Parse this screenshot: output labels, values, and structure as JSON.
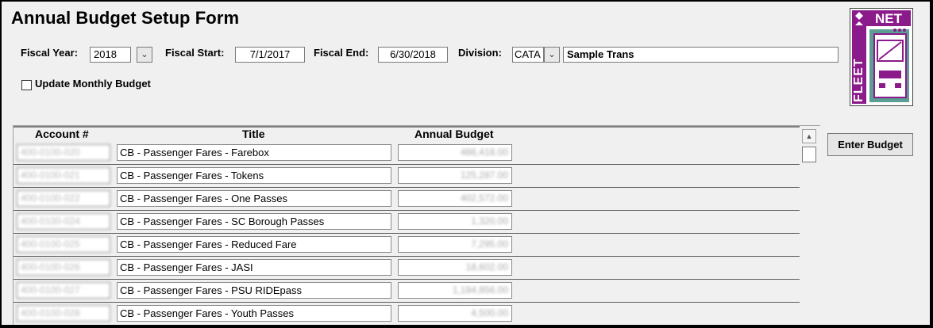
{
  "form": {
    "title": "Annual Budget Setup Form",
    "fiscal_year_label": "Fiscal Year:",
    "fiscal_year_value": "2018",
    "fiscal_start_label": "Fiscal Start:",
    "fiscal_start_value": "7/1/2017",
    "fiscal_end_label": "Fiscal End:",
    "fiscal_end_value": "6/30/2018",
    "division_label": "Division:",
    "division_code": "CATA",
    "division_name": "Sample Trans",
    "update_monthly_label": "Update Monthly Budget",
    "update_monthly_checked": false,
    "enter_budget_label": "Enter Budget"
  },
  "logo": {
    "text_top": "NET",
    "text_side": "FLEET",
    "colors": {
      "purple": "#8b1a8b",
      "teal": "#5a9e94"
    }
  },
  "grid": {
    "columns": [
      "Account #",
      "Title",
      "Annual Budget"
    ],
    "rows": [
      {
        "account": "400-0100-020",
        "title": "CB - Passenger Fares - Farebox",
        "budget": "486,418.00"
      },
      {
        "account": "400-0100-021",
        "title": "CB - Passenger Fares - Tokens",
        "budget": "125,287.00"
      },
      {
        "account": "400-0100-022",
        "title": "CB - Passenger Fares - One Passes",
        "budget": "402,572.00"
      },
      {
        "account": "400-0100-024",
        "title": "CB - Passenger Fares - SC Borough Passes",
        "budget": "1,320.00"
      },
      {
        "account": "400-0100-025",
        "title": "CB - Passenger Fares - Reduced Fare",
        "budget": "7,295.00"
      },
      {
        "account": "400-0100-026",
        "title": "CB - Passenger Fares - JASI",
        "budget": "18,602.00"
      },
      {
        "account": "400-0100-027",
        "title": "CB - Passenger Fares - PSU RIDEpass",
        "budget": "1,184,856.00"
      },
      {
        "account": "400-0100-028",
        "title": "CB - Passenger Fares - Youth Passes",
        "budget": "4,500.00"
      }
    ]
  }
}
